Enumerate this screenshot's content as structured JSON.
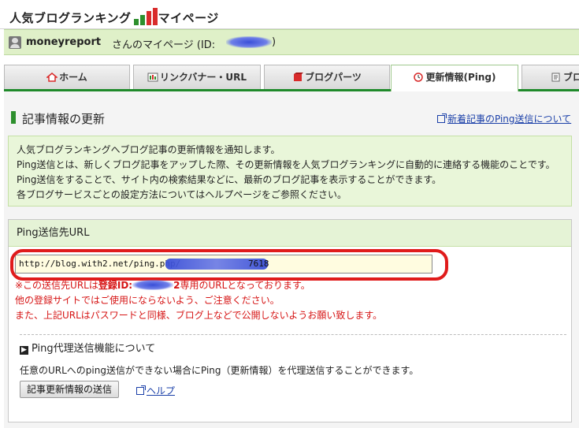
{
  "header": {
    "brand_part1": "人気ブログランキング",
    "brand_part2": "マイページ",
    "logo_icon": "ranking-chart-icon"
  },
  "user": {
    "name": "moneyreport",
    "suffix": " さんのマイページ (ID:",
    "id_close": ")",
    "avatar_icon": "user-icon"
  },
  "tabs": [
    {
      "label": "ホーム",
      "icon": "house-icon",
      "active": false
    },
    {
      "label": "リンクバナー・URL",
      "icon": "banner-icon",
      "active": false
    },
    {
      "label": "ブログパーツ",
      "icon": "cube-icon",
      "active": false
    },
    {
      "label": "更新情報(Ping)",
      "icon": "clock-icon",
      "active": true
    },
    {
      "label": "ブロ",
      "icon": "document-icon",
      "active": false
    }
  ],
  "section": {
    "title": "記事情報の更新",
    "help_link": "新着記事のPing送信について"
  },
  "info": {
    "line1": "人気ブログランキングへブログ記事の更新情報を通知します。",
    "line2": "Ping送信とは、新しくブログ記事をアップした際、その更新情報を人気ブログランキングに自動的に連絡する機能のことです。",
    "line3": "Ping送信をすることで、サイト内の検索結果などに、最新のブログ記事を表示することができます。",
    "line4": "各ブログサービスごとの設定方法についてはヘルプページをご参照ください。"
  },
  "ping": {
    "heading": "Ping送信先URL",
    "url_value": "http://blog.with2.net/ping.php/",
    "url_tail": "7618",
    "warn1_a": "※この送信先URLは",
    "warn1_b": "登録ID:",
    "warn1_c": "2",
    "warn1_d": "専用のURLとなっております。",
    "warn2": "他の登録サイトではご使用にならないよう、ご注意ください。",
    "warn3": "また、上記URLはパスワードと同様、ブログ上などで公開しないようお願い致します。"
  },
  "proxy": {
    "title": "Ping代理送信機能について",
    "desc": "任意のURLへのping送信ができない場合にPing（更新情報）を代理送信することができます。",
    "button": "記事更新情報の送信",
    "help": "ヘルプ"
  },
  "colors": {
    "accent_green": "#1f8a2a",
    "info_bg": "#e9f6d9",
    "warning_red": "#d61515",
    "highlight_ring": "#e01b1b",
    "link_blue": "#1a3fa8"
  }
}
